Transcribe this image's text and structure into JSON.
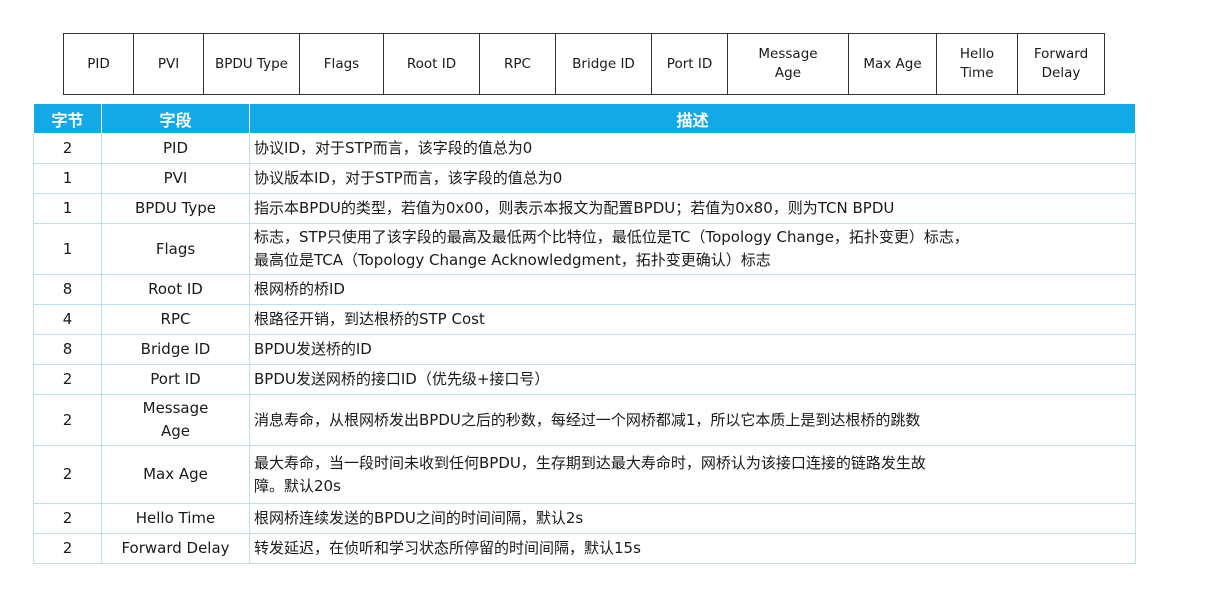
{
  "field_strip": [
    "PID",
    "PVI",
    "BPDU Type",
    "Flags",
    "Root ID",
    "RPC",
    "Bridge ID",
    "Port ID",
    "Message\nAge",
    "Max Age",
    "Hello\nTime",
    "Forward\nDelay"
  ],
  "table": {
    "headers": {
      "byte": "字节",
      "field": "字段",
      "desc": "描述"
    },
    "rows": [
      {
        "byte": "2",
        "field": "PID",
        "desc": "协议ID，对于STP而言，该字段的值总为0"
      },
      {
        "byte": "1",
        "field": "PVI",
        "desc": "协议版本ID，对于STP而言，该字段的值总为0"
      },
      {
        "byte": "1",
        "field": "BPDU Type",
        "desc": "指示本BPDU的类型，若值为0x00，则表示本报文为配置BPDU；若值为0x80，则为TCN BPDU"
      },
      {
        "byte": "1",
        "field": "Flags",
        "desc": "标志，STP只使用了该字段的最高及最低两个比特位，最低位是TC（Topology Change，拓扑变更）标志，\n最高位是TCA（Topology Change Acknowledgment，拓扑变更确认）标志"
      },
      {
        "byte": "8",
        "field": "Root ID",
        "desc": "根网桥的桥ID"
      },
      {
        "byte": "4",
        "field": "RPC",
        "desc": "根路径开销，到达根桥的STP Cost"
      },
      {
        "byte": "8",
        "field": "Bridge ID",
        "desc": "BPDU发送桥的ID"
      },
      {
        "byte": "2",
        "field": "Port ID",
        "desc": "BPDU发送网桥的接口ID（优先级+接口号）"
      },
      {
        "byte": "2",
        "field": "Message\nAge",
        "desc": "消息寿命，从根网桥发出BPDU之后的秒数，每经过一个网桥都减1，所以它本质上是到达根桥的跳数"
      },
      {
        "byte": "2",
        "field": "Max Age",
        "desc": "最大寿命，当一段时间未收到任何BPDU，生存期到达最大寿命时，网桥认为该接口连接的链路发生故\n障。默认20s"
      },
      {
        "byte": "2",
        "field": "Hello Time",
        "desc": "根网桥连续发送的BPDU之间的时间间隔，默认2s"
      },
      {
        "byte": "2",
        "field": "Forward Delay",
        "desc": "转发延迟，在侦听和学习状态所停留的时间间隔，默认15s"
      }
    ]
  }
}
